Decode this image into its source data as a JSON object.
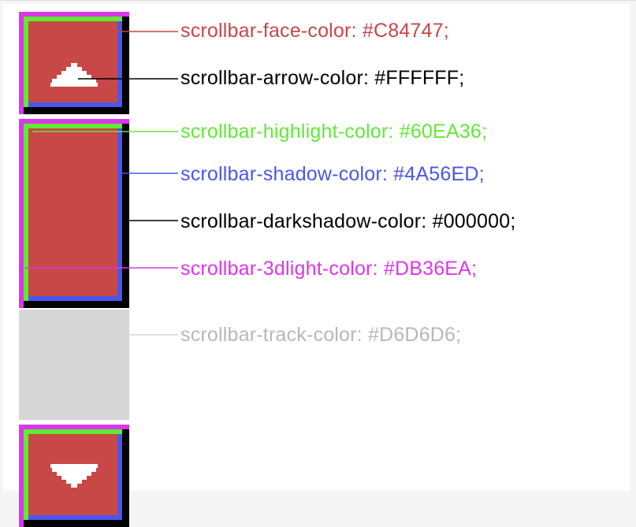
{
  "colors": {
    "face": "#C84747",
    "arrow": "#FFFFFF",
    "highlight": "#60EA36",
    "shadow": "#4A56ED",
    "darkshadow": "#000000",
    "threedlight": "#DB36EA",
    "track": "#D6D6D6"
  },
  "labels": {
    "face": "scrollbar-face-color: #C84747;",
    "arrow": "scrollbar-arrow-color: #FFFFFF;",
    "highlight": "scrollbar-highlight-color: #60EA36;",
    "shadow": "scrollbar-shadow-color: #4A56ED;",
    "darkshadow": "scrollbar-darkshadow-color: #000000;",
    "threedlight": "scrollbar-3dlight-color: #DB36EA;",
    "track": "scrollbar-track-color: #D6D6D6;"
  }
}
